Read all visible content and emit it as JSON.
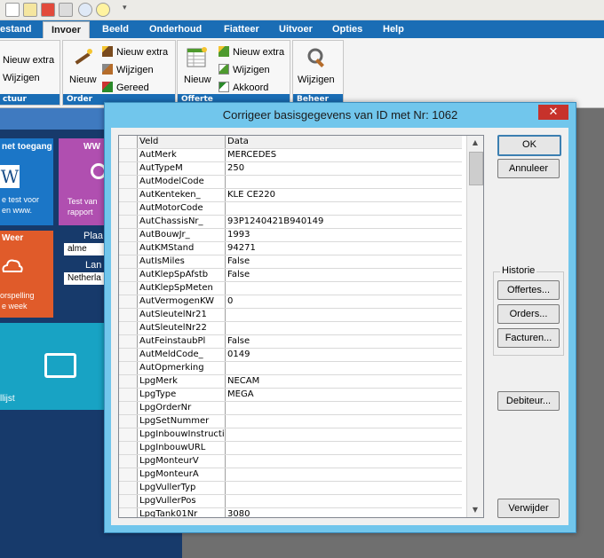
{
  "menu": {
    "items": [
      "estand",
      "Invoer",
      "Beeld",
      "Onderhoud",
      "Fiatteer",
      "Uitvoer",
      "Opties",
      "Help"
    ],
    "active_index": 1
  },
  "ribbon": {
    "group1": {
      "nieuw_extra": "Nieuw extra",
      "wijzigen": "Wijzigen",
      "title": "ctuur"
    },
    "group2": {
      "nieuw": "Nieuw",
      "nieuw_extra": "Nieuw extra",
      "wijzigen": "Wijzigen",
      "gereed": "Gereed",
      "title": "Order"
    },
    "group3": {
      "nieuw": "Nieuw",
      "nieuw_extra": "Nieuw extra",
      "wijzigen": "Wijzigen",
      "akkoord": "Akkoord",
      "title": "Offerte"
    },
    "group4": {
      "wijzigen": "Wijzigen",
      "title": "Beheer"
    }
  },
  "tiles": {
    "t1_title": "net toegang",
    "t1_text1": "e test voor",
    "t1_text2": "en www.",
    "t2_title": "WW",
    "t2_text1": "Test van",
    "t2_text2": "rapport",
    "t3_title": "Weer",
    "t3_text1": "orspelling",
    "t3_text2": "e week",
    "plaats_label": "Plaa",
    "plaats_value": "alme",
    "land_label": "Lan",
    "land_value": "Netherla",
    "t5_text": "llijst"
  },
  "dialog": {
    "title": "Corrigeer basisgegevens van ID met Nr: 1062",
    "close": "✕",
    "grid": {
      "headers": [
        "Veld",
        "Data"
      ],
      "rows": [
        [
          "AutMerk",
          "MERCEDES"
        ],
        [
          "AutTypeM",
          "250"
        ],
        [
          "AutModelCode",
          ""
        ],
        [
          "AutKenteken_",
          "KLE CE220"
        ],
        [
          "AutMotorCode",
          ""
        ],
        [
          "AutChassisNr_",
          "93P1240421B940149"
        ],
        [
          "AutBouwJr_",
          "1993"
        ],
        [
          "AutKMStand",
          "94271"
        ],
        [
          "AutIsMiles",
          "False"
        ],
        [
          "AutKlepSpAfstb",
          "False"
        ],
        [
          "AutKlepSpMeten",
          ""
        ],
        [
          "AutVermogenKW",
          "0"
        ],
        [
          "AutSleutelNr21",
          ""
        ],
        [
          "AutSleutelNr22",
          ""
        ],
        [
          "AutFeinstaubPl",
          "False"
        ],
        [
          "AutMeldCode_",
          "0149"
        ],
        [
          "AutOpmerking",
          ""
        ],
        [
          "LpgMerk",
          "NECAM"
        ],
        [
          "LpgType",
          "MEGA"
        ],
        [
          "LpgOrderNr",
          ""
        ],
        [
          "LpgSetNummer",
          ""
        ],
        [
          "LpgInbouwInstructie",
          ""
        ],
        [
          "LpgInbouwURL",
          ""
        ],
        [
          "LpgMonteurV",
          ""
        ],
        [
          "LpgMonteurA",
          ""
        ],
        [
          "LpgVullerTyp",
          ""
        ],
        [
          "LpgVullerPos",
          ""
        ],
        [
          "LpgTank01Nr",
          "3080"
        ]
      ]
    },
    "buttons": {
      "ok": "OK",
      "annuleer": "Annuleer",
      "historie": "Historie",
      "offertes": "Offertes...",
      "orders": "Orders...",
      "facturen": "Facturen...",
      "debiteur": "Debiteur...",
      "verwijder": "Verwijder"
    }
  },
  "colors": {
    "menubar": "#1a6db5",
    "dialog_frame": "#71c6ec",
    "close_button": "#c7322b",
    "tile_blue": "#1b76c7",
    "tile_purple": "#b04fb0",
    "tile_orange": "#e05b2a",
    "tile_teal": "#18a3c4"
  }
}
